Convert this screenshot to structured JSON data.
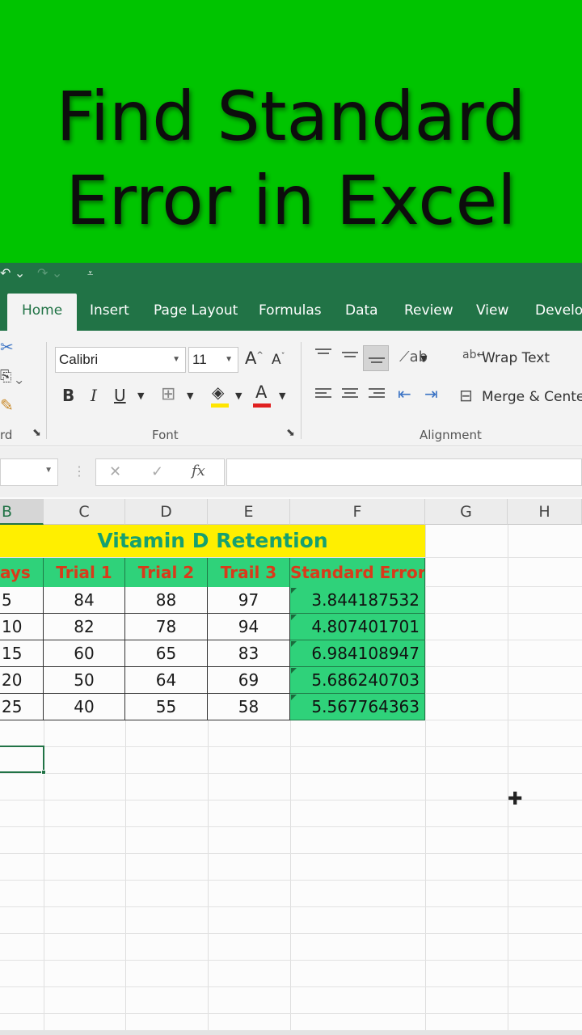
{
  "banner": {
    "title": "Find Standard\nError in Excel",
    "bg_color": "#00c400"
  },
  "qat": {
    "undo_icon": "undo-icon",
    "redo_icon": "redo-icon",
    "customize_icon": "customize-icon"
  },
  "ribbon": {
    "tabs": [
      "Home",
      "Insert",
      "Page Layout",
      "Formulas",
      "Data",
      "Review",
      "View",
      "Develop"
    ],
    "active_tab": "Home",
    "font_name": "Calibri",
    "font_size": "11",
    "grow_font": "A",
    "shrink_font": "A",
    "bold": "B",
    "italic": "I",
    "underline": "U",
    "font_color_letter": "A",
    "clipboard_label": "rd",
    "font_group_label": "Font",
    "alignment_group_label": "Alignment",
    "wrap_text": "Wrap Text",
    "merge_center": "Merge & Center"
  },
  "formula_bar": {
    "fx": "fx",
    "cancel": "✕",
    "enter": "✓",
    "value": ""
  },
  "columns": [
    "B",
    "C",
    "D",
    "E",
    "F",
    "G",
    "H"
  ],
  "selected_column": "B",
  "sheet": {
    "title": "Vitamin D Retention",
    "headers": [
      "ays",
      "Trial 1",
      "Trial 2",
      "Trail 3",
      "Standard Error"
    ],
    "rows": [
      [
        "5",
        "84",
        "88",
        "97",
        "3.844187532"
      ],
      [
        "10",
        "82",
        "78",
        "94",
        "4.807401701"
      ],
      [
        "15",
        "60",
        "65",
        "83",
        "6.984108947"
      ],
      [
        "20",
        "50",
        "64",
        "69",
        "5.686240703"
      ],
      [
        "25",
        "40",
        "55",
        "58",
        "5.567764363"
      ]
    ]
  },
  "colors": {
    "excel_green": "#217346",
    "title_fill": "#ffef00",
    "header_fill": "#2fd27a",
    "header_text": "#d93a1a"
  }
}
